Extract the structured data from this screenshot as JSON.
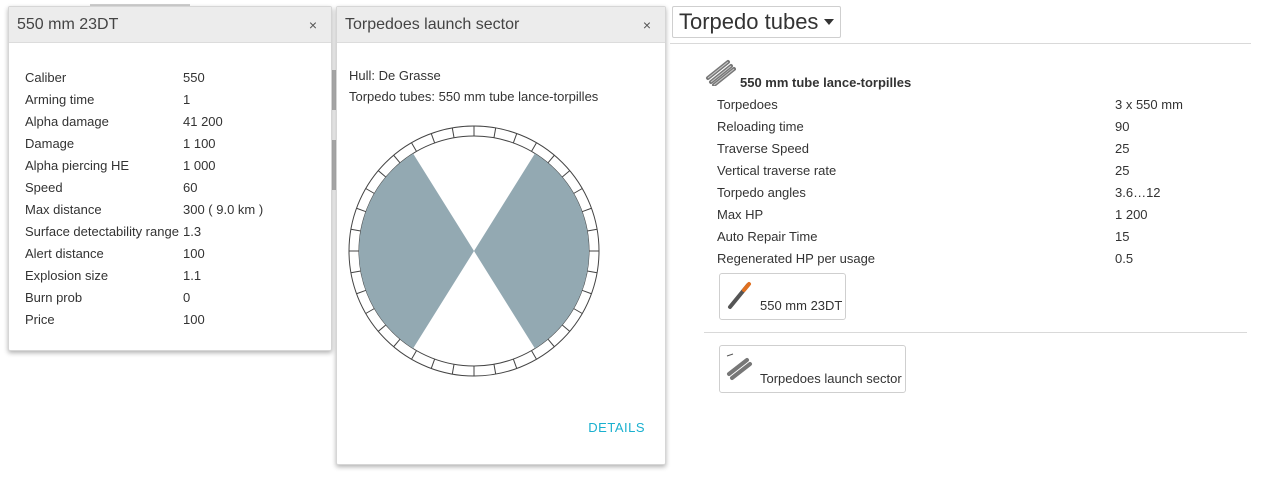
{
  "ammo_panel": {
    "title": "550 mm 23DT",
    "close_label": "×",
    "stats": [
      {
        "label": "Caliber",
        "value": "550"
      },
      {
        "label": "Arming time",
        "value": "1"
      },
      {
        "label": "Alpha damage",
        "value": "41 200"
      },
      {
        "label": "Damage",
        "value": "1 100"
      },
      {
        "label": "Alpha piercing HE",
        "value": "1 000"
      },
      {
        "label": "Speed",
        "value": "60"
      },
      {
        "label": "Max distance",
        "value": "300 ( 9.0 km )"
      },
      {
        "label": "Surface detectability range",
        "value": "1.3"
      },
      {
        "label": "Alert distance",
        "value": "100"
      },
      {
        "label": "Explosion size",
        "value": "1.1"
      },
      {
        "label": "Burn prob",
        "value": "0"
      },
      {
        "label": "Price",
        "value": "100"
      }
    ]
  },
  "sector_panel": {
    "title": "Torpedoes launch sector",
    "close_label": "×",
    "hull_line": "Hull: De Grasse",
    "tubes_line": "Torpedo tubes: 550 mm tube lance-torpilles",
    "details_label": "DETAILS",
    "sector_color": "#93a9b2"
  },
  "tubes": {
    "dropdown_label": "Torpedo tubes",
    "module_title": "550 mm tube lance-torpilles",
    "stats": [
      {
        "label": "Torpedoes",
        "value": "3 x 550 mm"
      },
      {
        "label": "Reloading time",
        "value": "90"
      },
      {
        "label": "Traverse Speed",
        "value": "25"
      },
      {
        "label": "Vertical traverse rate",
        "value": "25"
      },
      {
        "label": "Torpedo angles",
        "value": "3.6…12"
      },
      {
        "label": "Max HP",
        "value": "1 200"
      },
      {
        "label": "Auto Repair Time",
        "value": "15"
      },
      {
        "label": "Regenerated HP per usage",
        "value": "0.5"
      }
    ],
    "torpedo_button_label": "550 mm 23DT",
    "sector_button_label": "Torpedoes launch sector"
  }
}
